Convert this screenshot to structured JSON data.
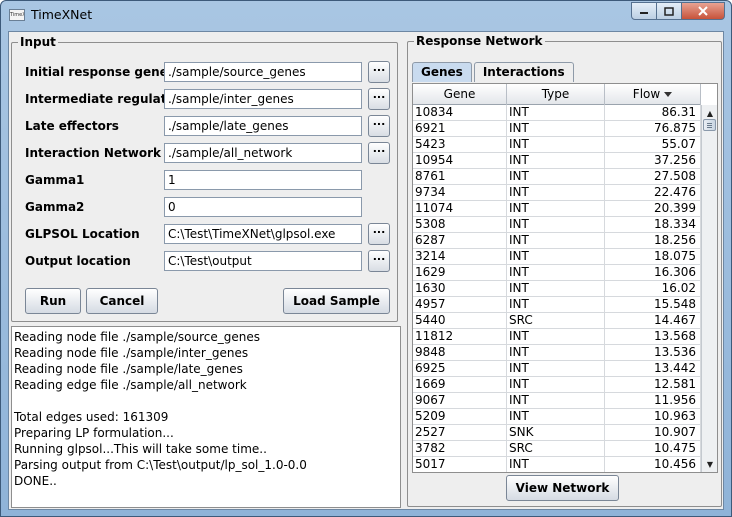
{
  "window": {
    "title": "TimeXNet",
    "icon_text": "TimeXNet"
  },
  "input_panel": {
    "title": "Input",
    "fields": [
      {
        "label": "Initial response genes",
        "value": "./sample/source_genes",
        "browse": "..."
      },
      {
        "label": "Intermediate regulators",
        "value": "./sample/inter_genes",
        "browse": "..."
      },
      {
        "label": "Late effectors",
        "value": "./sample/late_genes",
        "browse": "..."
      },
      {
        "label": "Interaction Network",
        "value": "./sample/all_network",
        "browse": "..."
      },
      {
        "label": "Gamma1",
        "value": "1"
      },
      {
        "label": "Gamma2",
        "value": "0"
      },
      {
        "label": "GLPSOL Location",
        "value": "C:\\Test\\TimeXNet\\glpsol.exe",
        "browse": "..."
      },
      {
        "label": "Output location",
        "value": "C:\\Test\\output",
        "browse": "..."
      }
    ],
    "run_label": "Run",
    "cancel_label": "Cancel",
    "load_sample_label": "Load Sample"
  },
  "log": [
    "Reading node file ./sample/source_genes",
    "Reading node file ./sample/inter_genes",
    "Reading node file ./sample/late_genes",
    "Reading edge file ./sample/all_network",
    "",
    "Total edges used: 161309",
    "Preparing LP formulation...",
    "Running glpsol...This will take some time..",
    "Parsing output from C:\\Test\\output/lp_sol_1.0-0.0",
    "DONE.."
  ],
  "response_panel": {
    "title": "Response Network",
    "tabs": [
      "Genes",
      "Interactions"
    ],
    "active_tab": "Genes",
    "columns": [
      "Gene",
      "Type",
      "Flow"
    ],
    "sorted_column": "Flow",
    "rows": [
      [
        "10834",
        "INT",
        "86.31"
      ],
      [
        "6921",
        "INT",
        "76.875"
      ],
      [
        "5423",
        "INT",
        "55.07"
      ],
      [
        "10954",
        "INT",
        "37.256"
      ],
      [
        "8761",
        "INT",
        "27.508"
      ],
      [
        "9734",
        "INT",
        "22.476"
      ],
      [
        "11074",
        "INT",
        "20.399"
      ],
      [
        "5308",
        "INT",
        "18.334"
      ],
      [
        "6287",
        "INT",
        "18.256"
      ],
      [
        "3214",
        "INT",
        "18.075"
      ],
      [
        "1629",
        "INT",
        "16.306"
      ],
      [
        "1630",
        "INT",
        "16.02"
      ],
      [
        "4957",
        "INT",
        "15.548"
      ],
      [
        "5440",
        "SRC",
        "14.467"
      ],
      [
        "11812",
        "INT",
        "13.568"
      ],
      [
        "9848",
        "INT",
        "13.536"
      ],
      [
        "6925",
        "INT",
        "13.442"
      ],
      [
        "1669",
        "INT",
        "12.581"
      ],
      [
        "9067",
        "INT",
        "11.956"
      ],
      [
        "5209",
        "INT",
        "10.963"
      ],
      [
        "2527",
        "SNK",
        "10.907"
      ],
      [
        "3782",
        "SRC",
        "10.475"
      ],
      [
        "5017",
        "INT",
        "10.456"
      ]
    ],
    "view_network_label": "View Network"
  },
  "icons": {
    "minimize": "minimize-icon",
    "maximize": "maximize-icon",
    "close": "close-icon",
    "sort": "sort-descending-icon",
    "scroll_up": "scroll-up-arrow-icon",
    "scroll_down": "scroll-down-arrow-icon"
  }
}
